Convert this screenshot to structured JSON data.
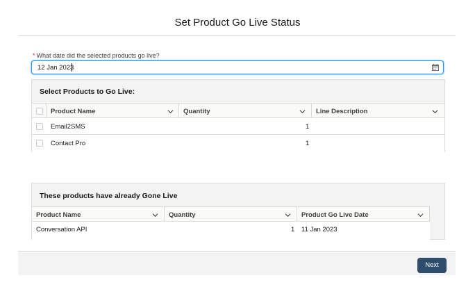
{
  "page": {
    "title": "Set Product Go Live Status"
  },
  "date_field": {
    "required_marker": "*",
    "label": "What date did the selected products go live?",
    "value": "12 Jan 2023",
    "icon": "calendar-icon"
  },
  "select_section": {
    "title": "Select Products to Go Live:",
    "columns": [
      "Product Name",
      "Quantity",
      "Line Description"
    ],
    "rows": [
      {
        "product": "Email2SMS",
        "quantity": "1",
        "description": "",
        "checked": false
      },
      {
        "product": "Contact Pro",
        "quantity": "1",
        "description": "",
        "checked": false
      }
    ]
  },
  "live_section": {
    "title": "These products have already Gone Live",
    "columns": [
      "Product Name",
      "Quantity",
      "Product Go Live Date"
    ],
    "rows": [
      {
        "product": "Conversation API",
        "quantity": "1",
        "go_live_date": "11 Jan 2023"
      }
    ]
  },
  "footer": {
    "next_label": "Next"
  },
  "colors": {
    "accent": "#1b96ff",
    "button": "#2e4d6d",
    "panel": "#f3f3f3",
    "required": "#c23934"
  }
}
